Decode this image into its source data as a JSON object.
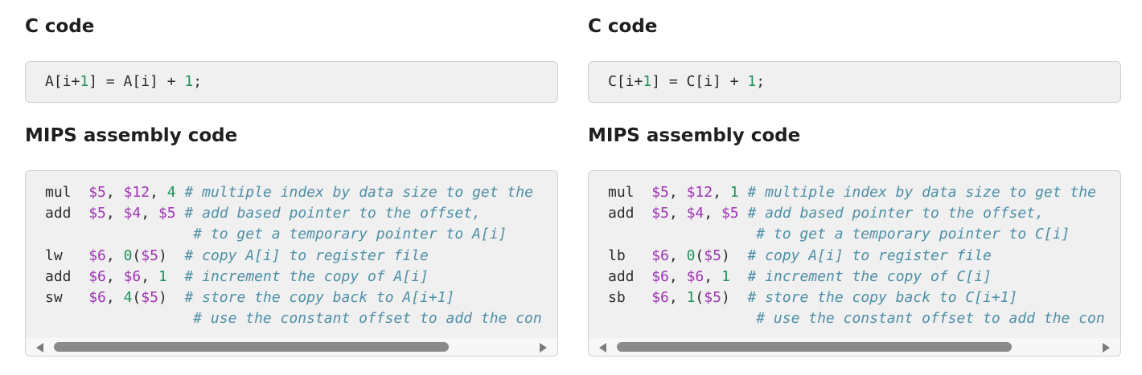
{
  "panels": [
    {
      "c_heading": "C code",
      "c_code": [
        {
          "t": "A[i+",
          "k": "plain"
        },
        {
          "t": "1",
          "k": "num"
        },
        {
          "t": "] = A[i] + ",
          "k": "plain"
        },
        {
          "t": "1",
          "k": "num"
        },
        {
          "t": ";",
          "k": "plain"
        }
      ],
      "asm_heading": "MIPS assembly code",
      "asm_lines": [
        [
          {
            "t": "mul  ",
            "k": "plain"
          },
          {
            "t": "$5",
            "k": "reg"
          },
          {
            "t": ", ",
            "k": "plain"
          },
          {
            "t": "$12",
            "k": "reg"
          },
          {
            "t": ", ",
            "k": "plain"
          },
          {
            "t": "4",
            "k": "num"
          },
          {
            "t": " ",
            "k": "plain"
          },
          {
            "t": "# multiple index by data size to get the",
            "k": "cmt"
          }
        ],
        [
          {
            "t": "add  ",
            "k": "plain"
          },
          {
            "t": "$5",
            "k": "reg"
          },
          {
            "t": ", ",
            "k": "plain"
          },
          {
            "t": "$4",
            "k": "reg"
          },
          {
            "t": ", ",
            "k": "plain"
          },
          {
            "t": "$5",
            "k": "reg"
          },
          {
            "t": " ",
            "k": "plain"
          },
          {
            "t": "# add based pointer to the offset,",
            "k": "cmt"
          }
        ],
        [
          {
            "t": "                 ",
            "k": "plain"
          },
          {
            "t": "# to get a temporary pointer to A[i]",
            "k": "cmt"
          }
        ],
        [
          {
            "t": "lw   ",
            "k": "plain"
          },
          {
            "t": "$6",
            "k": "reg"
          },
          {
            "t": ", ",
            "k": "plain"
          },
          {
            "t": "0",
            "k": "num"
          },
          {
            "t": "(",
            "k": "plain"
          },
          {
            "t": "$5",
            "k": "reg"
          },
          {
            "t": ")  ",
            "k": "plain"
          },
          {
            "t": "# copy A[i] to register file",
            "k": "cmt"
          }
        ],
        [
          {
            "t": "add  ",
            "k": "plain"
          },
          {
            "t": "$6",
            "k": "reg"
          },
          {
            "t": ", ",
            "k": "plain"
          },
          {
            "t": "$6",
            "k": "reg"
          },
          {
            "t": ", ",
            "k": "plain"
          },
          {
            "t": "1",
            "k": "num"
          },
          {
            "t": "  ",
            "k": "plain"
          },
          {
            "t": "# increment the copy of A[i]",
            "k": "cmt"
          }
        ],
        [
          {
            "t": "sw   ",
            "k": "plain"
          },
          {
            "t": "$6",
            "k": "reg"
          },
          {
            "t": ", ",
            "k": "plain"
          },
          {
            "t": "4",
            "k": "num"
          },
          {
            "t": "(",
            "k": "plain"
          },
          {
            "t": "$5",
            "k": "reg"
          },
          {
            "t": ")  ",
            "k": "plain"
          },
          {
            "t": "# store the copy back to A[i+1]",
            "k": "cmt"
          }
        ],
        [
          {
            "t": "                 ",
            "k": "plain"
          },
          {
            "t": "# use the constant offset to add the con",
            "k": "cmt"
          }
        ]
      ]
    },
    {
      "c_heading": "C code",
      "c_code": [
        {
          "t": "C[i+",
          "k": "plain"
        },
        {
          "t": "1",
          "k": "num"
        },
        {
          "t": "] = C[i] + ",
          "k": "plain"
        },
        {
          "t": "1",
          "k": "num"
        },
        {
          "t": ";",
          "k": "plain"
        }
      ],
      "asm_heading": "MIPS assembly code",
      "asm_lines": [
        [
          {
            "t": "mul  ",
            "k": "plain"
          },
          {
            "t": "$5",
            "k": "reg"
          },
          {
            "t": ", ",
            "k": "plain"
          },
          {
            "t": "$12",
            "k": "reg"
          },
          {
            "t": ", ",
            "k": "plain"
          },
          {
            "t": "1",
            "k": "num"
          },
          {
            "t": " ",
            "k": "plain"
          },
          {
            "t": "# multiple index by data size to get the",
            "k": "cmt"
          }
        ],
        [
          {
            "t": "add  ",
            "k": "plain"
          },
          {
            "t": "$5",
            "k": "reg"
          },
          {
            "t": ", ",
            "k": "plain"
          },
          {
            "t": "$4",
            "k": "reg"
          },
          {
            "t": ", ",
            "k": "plain"
          },
          {
            "t": "$5",
            "k": "reg"
          },
          {
            "t": " ",
            "k": "plain"
          },
          {
            "t": "# add based pointer to the offset,",
            "k": "cmt"
          }
        ],
        [
          {
            "t": "                 ",
            "k": "plain"
          },
          {
            "t": "# to get a temporary pointer to C[i]",
            "k": "cmt"
          }
        ],
        [
          {
            "t": "lb   ",
            "k": "plain"
          },
          {
            "t": "$6",
            "k": "reg"
          },
          {
            "t": ", ",
            "k": "plain"
          },
          {
            "t": "0",
            "k": "num"
          },
          {
            "t": "(",
            "k": "plain"
          },
          {
            "t": "$5",
            "k": "reg"
          },
          {
            "t": ")  ",
            "k": "plain"
          },
          {
            "t": "# copy A[i] to register file",
            "k": "cmt"
          }
        ],
        [
          {
            "t": "add  ",
            "k": "plain"
          },
          {
            "t": "$6",
            "k": "reg"
          },
          {
            "t": ", ",
            "k": "plain"
          },
          {
            "t": "$6",
            "k": "reg"
          },
          {
            "t": ", ",
            "k": "plain"
          },
          {
            "t": "1",
            "k": "num"
          },
          {
            "t": "  ",
            "k": "plain"
          },
          {
            "t": "# increment the copy of C[i]",
            "k": "cmt"
          }
        ],
        [
          {
            "t": "sb   ",
            "k": "plain"
          },
          {
            "t": "$6",
            "k": "reg"
          },
          {
            "t": ", ",
            "k": "plain"
          },
          {
            "t": "1",
            "k": "num"
          },
          {
            "t": "(",
            "k": "plain"
          },
          {
            "t": "$5",
            "k": "reg"
          },
          {
            "t": ")  ",
            "k": "plain"
          },
          {
            "t": "# store the copy back to C[i+1]",
            "k": "cmt"
          }
        ],
        [
          {
            "t": "                 ",
            "k": "plain"
          },
          {
            "t": "# use the constant offset to add the con",
            "k": "cmt"
          }
        ]
      ]
    }
  ],
  "colors": {
    "register": "#a033b6",
    "number": "#21915c",
    "comment": "#4d8fa6",
    "code_background": "#f0f0f0"
  },
  "icons": {
    "scroll_left": "scroll-left-arrow-icon",
    "scroll_right": "scroll-right-arrow-icon"
  }
}
